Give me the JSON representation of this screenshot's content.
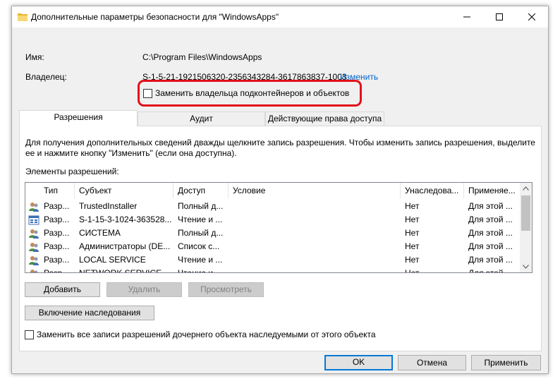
{
  "window": {
    "title": "Дополнительные параметры безопасности  для \"WindowsApps\""
  },
  "info": {
    "name_label": "Имя:",
    "name_value": "C:\\Program Files\\WindowsApps",
    "owner_label": "Владелец:",
    "owner_value": "S-1-5-21-1921506320-2356343284-3617863837-1003",
    "change_link": "Изменить",
    "replace_owner_label": "Заменить владельца подконтейнеров и объектов"
  },
  "tabs": [
    {
      "label": "Разрешения",
      "active": true
    },
    {
      "label": "Аудит",
      "active": false
    },
    {
      "label": "Действующие права доступа",
      "active": false
    }
  ],
  "permissions": {
    "description": "Для получения дополнительных сведений дважды щелкните запись разрешения. Чтобы изменить запись разрешения, выделите",
    "description2": "ее и нажмите кнопку \"Изменить\" (если она доступна).",
    "list_label": "Элементы разрешений:",
    "columns": [
      "Тип",
      "Субъект",
      "Доступ",
      "Условие",
      "Унаследова...",
      "Применяе..."
    ],
    "rows": [
      {
        "icon": "users-icon",
        "type": "Разр...",
        "principal": "TrustedInstaller",
        "access": "Полный д...",
        "condition": "",
        "inherited": "Нет",
        "applies": "Для этой ..."
      },
      {
        "icon": "app-package-icon",
        "type": "Разр...",
        "principal": "S-1-15-3-1024-363528...",
        "access": "Чтение и ...",
        "condition": "",
        "inherited": "Нет",
        "applies": "Для этой ..."
      },
      {
        "icon": "users-icon",
        "type": "Разр...",
        "principal": "СИСТЕМА",
        "access": "Полный д...",
        "condition": "",
        "inherited": "Нет",
        "applies": "Для этой ..."
      },
      {
        "icon": "users-icon",
        "type": "Разр...",
        "principal": "Администраторы (DE...",
        "access": "Список с...",
        "condition": "",
        "inherited": "Нет",
        "applies": "Для этой ..."
      },
      {
        "icon": "users-icon",
        "type": "Разр...",
        "principal": "LOCAL SERVICE",
        "access": "Чтение и ...",
        "condition": "",
        "inherited": "Нет",
        "applies": "Для этой ..."
      },
      {
        "icon": "users-icon",
        "type": "Разр...",
        "principal": "NETWORK SERVICE",
        "access": "Чтение и ...",
        "condition": "",
        "inherited": "Нет",
        "applies": "Для этой ..."
      }
    ],
    "add_button": "Добавить",
    "remove_button": "Удалить",
    "view_button": "Просмотреть",
    "inheritance_button": "Включение наследования",
    "replace_child_label": "Заменить все записи разрешений дочернего объекта наследуемыми от этого объекта"
  },
  "footer": {
    "ok": "OK",
    "cancel": "Отмена",
    "apply": "Применить"
  },
  "colors": {
    "highlight": "#e3101a",
    "link": "#0066cc",
    "default_button_border": "#0078d7"
  }
}
